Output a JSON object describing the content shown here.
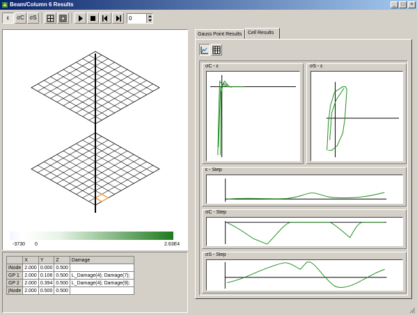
{
  "window": {
    "title": "Beam/Column 6 Results",
    "buttons": [
      "_",
      "□",
      "×"
    ]
  },
  "toolbar": {
    "mode_buttons": [
      "ε",
      "σC",
      "σS"
    ],
    "step_value": "0"
  },
  "colorbar": {
    "min_label": "-3730",
    "zero_label": "0",
    "max_label": "2.63E4"
  },
  "node_table": {
    "headers": [
      "",
      "X",
      "Y",
      "Z",
      "Damage"
    ],
    "rows": [
      [
        "iNode",
        "2.000",
        "0.000",
        "0.500",
        ""
      ],
      [
        "GP 1",
        "2.000",
        "0.106",
        "0.500",
        "L_Damage(4); Damage(7);"
      ],
      [
        "GP 2",
        "2.000",
        "0.394",
        "0.500",
        "L_Damage(4); Damage(9);"
      ],
      [
        "jNode",
        "2.000",
        "0.500",
        "0.500",
        ""
      ]
    ]
  },
  "tabs": [
    {
      "label": "Gauss Point Results",
      "active": false
    },
    {
      "label": "Cell Results",
      "active": true
    }
  ],
  "plots": {
    "sc_eps": "σC - ε",
    "ss_eps": "σS - ε",
    "eps_step": "ε - Step",
    "sc_step": "σC - Step",
    "ss_step": "σS - Step"
  },
  "colors": {
    "curve": "#1a8a1a",
    "colorbar_end": "#1e7a1e",
    "highlight": "#f0a050"
  }
}
